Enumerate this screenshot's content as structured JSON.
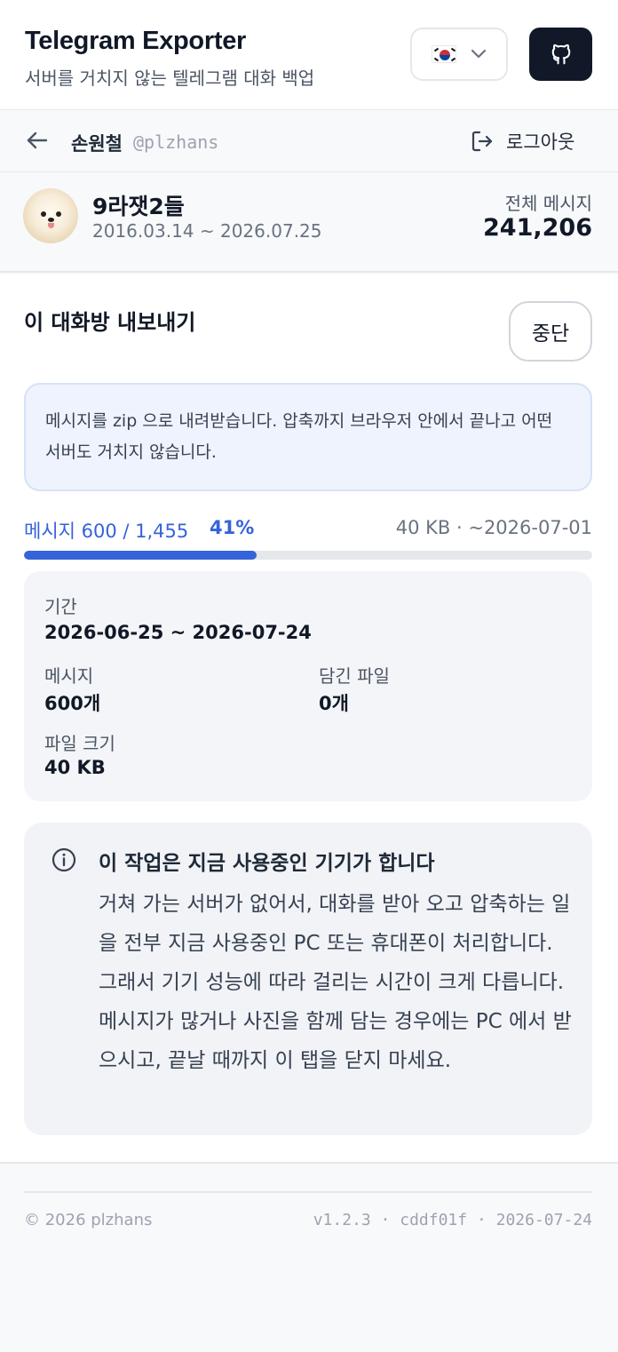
{
  "header": {
    "app_title": "Telegram Exporter",
    "app_subtitle": "서버를 거치지 않는 텔레그램 대화 백업",
    "language_flag": "kr-flag-icon",
    "github_icon": "github-icon"
  },
  "user_bar": {
    "name": "손원철",
    "handle": "@plzhans",
    "logout_label": "로그아웃"
  },
  "chat": {
    "name": "9라잿2들",
    "date_range": "2016.03.14 ~ 2026.07.25",
    "total_label": "전체 메시지",
    "total_value": "241,206"
  },
  "export": {
    "title": "이 대화방 내보내기",
    "stop_label": "중단",
    "notice": "메시지를 zip 으로 내려받습니다. 압축까지 브라우저 안에서 끝나고 어떤 서버도 거치지 않습니다.",
    "progress_label": "메시지 600 / 1,455",
    "progress_percent_text": "41%",
    "progress_fraction": 0.41,
    "progress_meta": "40 KB · ~2026-07-01",
    "accent_color": "#3563d9"
  },
  "stats": {
    "period_label": "기간",
    "period_value": "2026-06-25 ~ 2026-07-24",
    "messages_label": "메시지",
    "messages_value": "600개",
    "files_label": "담긴 파일",
    "files_value": "0개",
    "size_label": "파일 크기",
    "size_value": "40 KB"
  },
  "info": {
    "title": "이 작업은 지금 사용중인 기기가 합니다",
    "body": "거쳐 가는 서버가 없어서, 대화를 받아 오고 압축하는 일을 전부 지금 사용중인 PC 또는 휴대폰이 처리합니다. 그래서 기기 성능에 따라 걸리는 시간이 크게 다릅니다. 메시지가 많거나 사진을 함께 담는 경우에는 PC 에서 받으시고, 끝날 때까지 이 탭을 닫지 마세요."
  },
  "footer": {
    "copyright": "© 2026 plzhans",
    "version": "v1.2.3 · cddf01f · 2026-07-24"
  }
}
